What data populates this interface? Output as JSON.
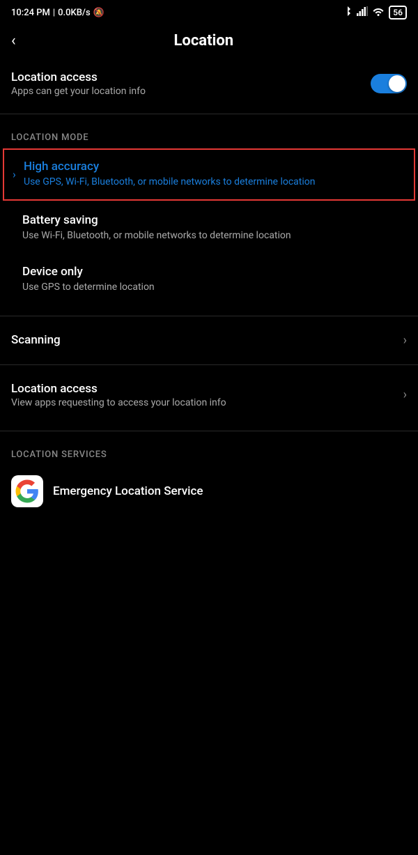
{
  "statusBar": {
    "time": "10:24 PM",
    "network": "0.0KB/s",
    "battery": "56"
  },
  "header": {
    "back_label": "<",
    "title": "Location"
  },
  "locationAccess": {
    "label": "Location access",
    "description": "Apps can get your location info",
    "enabled": true
  },
  "locationMode": {
    "sectionLabel": "LOCATION MODE",
    "modes": [
      {
        "id": "high-accuracy",
        "title": "High accuracy",
        "description": "Use GPS, Wi-Fi, Bluetooth, or mobile networks to determine location",
        "selected": true
      },
      {
        "id": "battery-saving",
        "title": "Battery saving",
        "description": "Use Wi-Fi, Bluetooth, or mobile networks to determine location",
        "selected": false
      },
      {
        "id": "device-only",
        "title": "Device only",
        "description": "Use GPS to determine location",
        "selected": false
      }
    ]
  },
  "navItems": [
    {
      "id": "scanning",
      "title": "Scanning",
      "subtitle": ""
    },
    {
      "id": "location-access",
      "title": "Location access",
      "subtitle": "View apps requesting to access your location info"
    }
  ],
  "locationServices": {
    "sectionLabel": "LOCATION SERVICES",
    "items": [
      {
        "id": "emergency-location",
        "name": "Emergency Location Service",
        "hasIcon": true
      }
    ]
  }
}
